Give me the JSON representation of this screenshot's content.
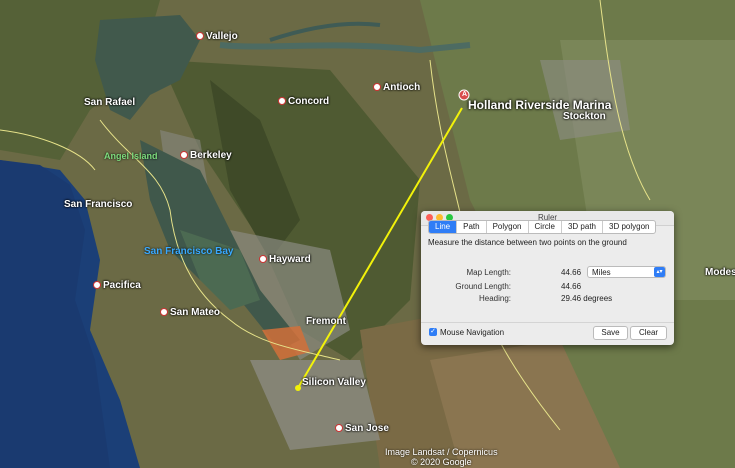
{
  "map": {
    "places": [
      {
        "name": "Vallejo"
      },
      {
        "name": "Antioch"
      },
      {
        "name": "San Rafael"
      },
      {
        "name": "Concord"
      },
      {
        "name": "Berkeley"
      },
      {
        "name": "San Francisco"
      },
      {
        "name": "Hayward"
      },
      {
        "name": "Pacifica"
      },
      {
        "name": "San Mateo"
      },
      {
        "name": "Fremont"
      },
      {
        "name": "Silicon Valley"
      },
      {
        "name": "San Jose"
      },
      {
        "name": "Stockton"
      },
      {
        "name": "Modes"
      }
    ],
    "bay_label": "San Francisco Bay",
    "island_label": "Angel Island",
    "marker_label": "Holland Riverside Marina",
    "marker_letter": "A",
    "credits_line1": "Image Landsat / Copernicus",
    "credits_line2": "© 2020 Google"
  },
  "ruler": {
    "title": "Ruler",
    "tabs": [
      "Line",
      "Path",
      "Polygon",
      "Circle",
      "3D path",
      "3D polygon"
    ],
    "active_tab": "Line",
    "description": "Measure the distance between two points on the ground",
    "map_length_label": "Map Length:",
    "map_length_value": "44.66",
    "unit": "Miles",
    "ground_length_label": "Ground Length:",
    "ground_length_value": "44.66",
    "heading_label": "Heading:",
    "heading_value": "29.46 degrees",
    "mouse_nav_label": "Mouse Navigation",
    "mouse_nav_checked": true,
    "save_label": "Save",
    "clear_label": "Clear"
  }
}
